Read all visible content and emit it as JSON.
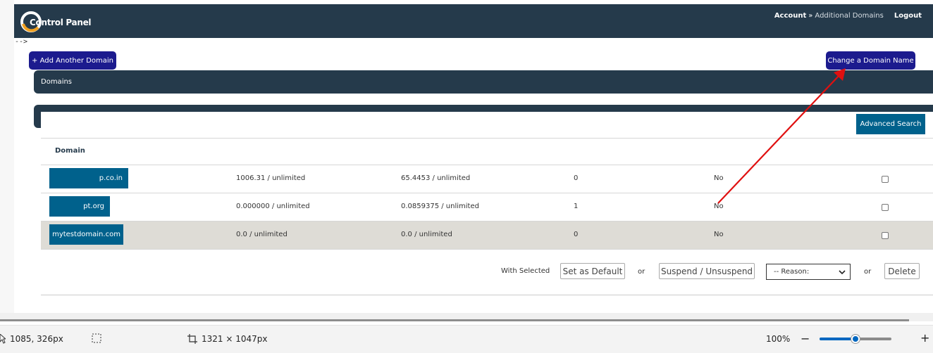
{
  "header": {
    "logo_text": "Control Panel",
    "breadcrumb_account": "Account",
    "breadcrumb_sep": "»",
    "breadcrumb_current": "Additional Domains",
    "logout_label": "Logout"
  },
  "stray_text": "-->",
  "buttons": {
    "add_domain": "+ Add Another Domain",
    "change_domain": "Change a Domain Name",
    "advanced_search": "Advanced Search"
  },
  "section_title": "Domains",
  "table": {
    "column_header": "Domain",
    "rows": [
      {
        "domain": "p.co.in",
        "bandwidth": "1006.31 / unlimited",
        "disk": "65.4453 / unlimited",
        "count": "0",
        "suspended": "No",
        "checked": false
      },
      {
        "domain": "pt.org",
        "bandwidth": "0.000000 / unlimited",
        "disk": "0.0859375 / unlimited",
        "count": "1",
        "suspended": "No",
        "checked": false
      },
      {
        "domain": "mytestdomain.com",
        "bandwidth": "0.0 / unlimited",
        "disk": "0.0 / unlimited",
        "count": "0",
        "suspended": "No",
        "checked": false
      }
    ]
  },
  "bulk_actions": {
    "with_selected": "With Selected",
    "set_default": "Set as Default",
    "or1": "or",
    "suspend": "Suspend / Unsuspend",
    "reason_selected": "-- Reason:",
    "or2": "or",
    "delete": "Delete"
  },
  "statusbar": {
    "cursor_pos": "1085, 326px",
    "selection_size": "1321 × 1047px",
    "zoom": "100%",
    "zoom_level": 0.5
  },
  "colors": {
    "navy": "#253a4b",
    "button_blue": "#1c1b8e",
    "chip_blue": "#00618c",
    "annotation_red": "#e01010"
  },
  "icons": [
    "logo-swirl-icon",
    "cursor-icon",
    "selection-icon",
    "crop-icon",
    "zoom-out-icon",
    "zoom-in-icon",
    "chevron-down-icon"
  ]
}
